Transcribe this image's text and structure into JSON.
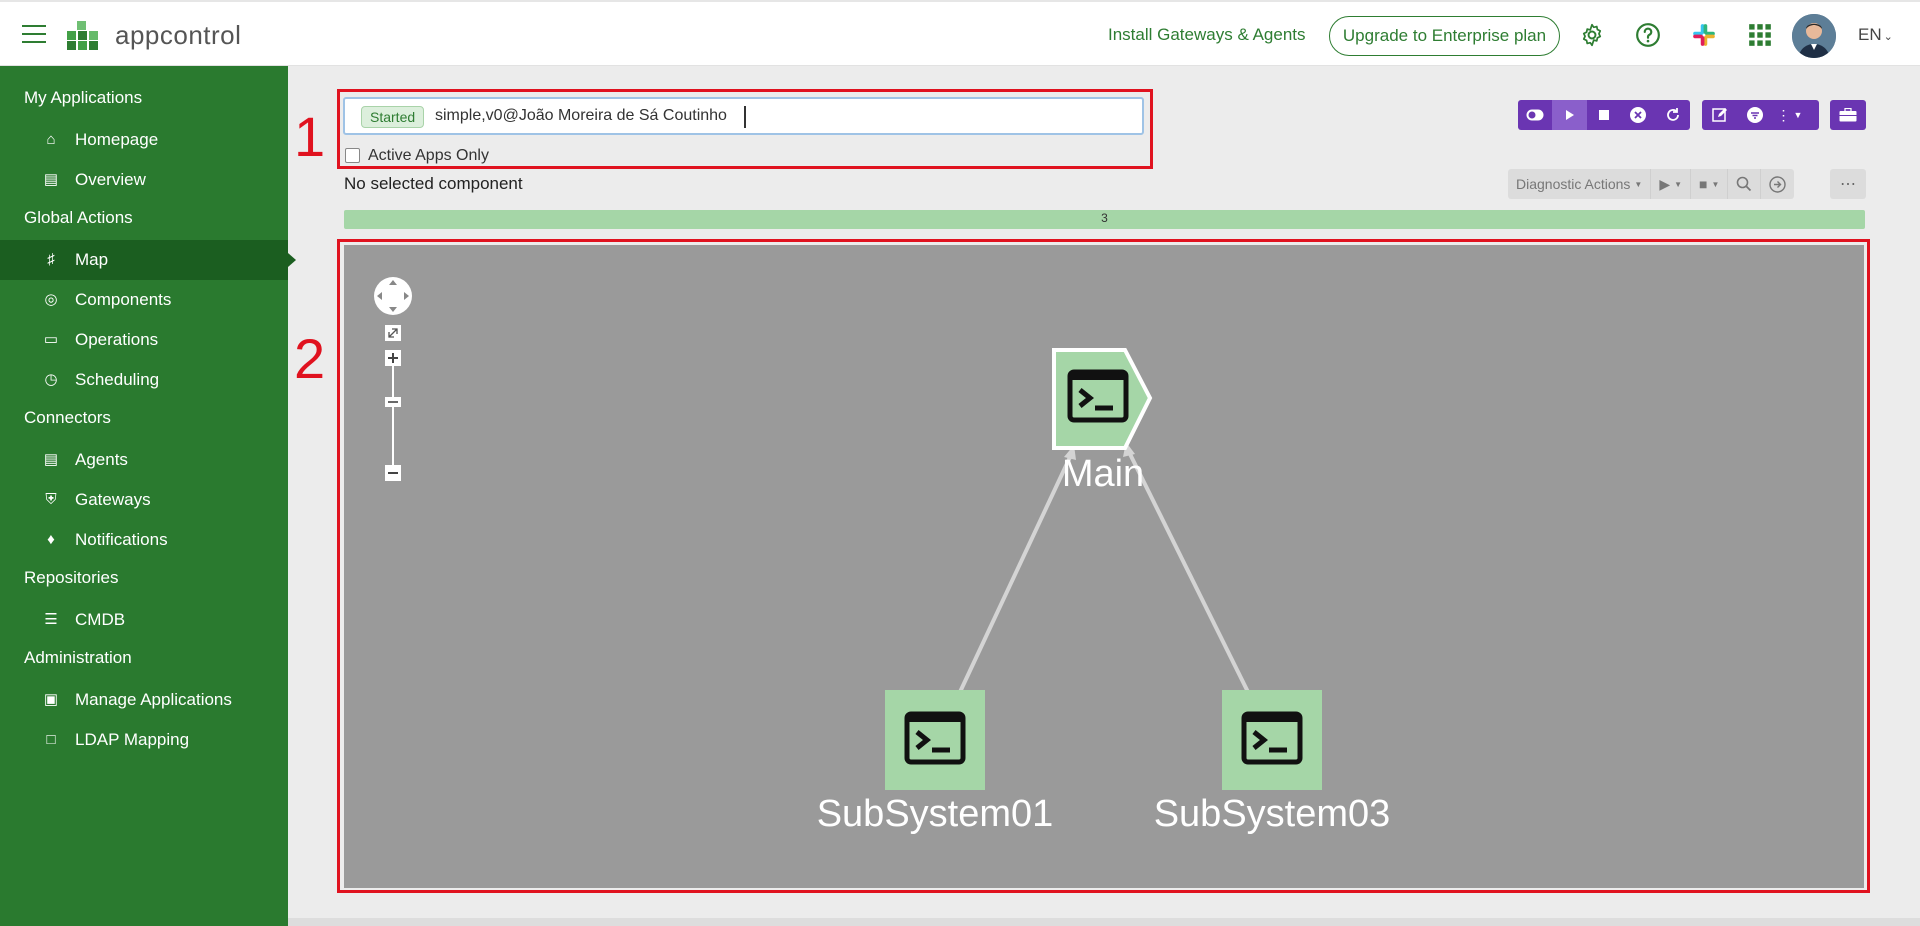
{
  "header": {
    "app_name": "appcontrol",
    "install_link": "Install Gateways & Agents",
    "upgrade_button": "Upgrade to Enterprise plan",
    "language": "EN",
    "icons": [
      "menu-icon",
      "settings-gear-icon",
      "help-icon",
      "slack-icon",
      "apps-grid-icon",
      "user-avatar"
    ]
  },
  "sidebar": {
    "sections": [
      {
        "label": "My Applications",
        "items": [
          {
            "label": "Homepage",
            "icon": "home-icon"
          },
          {
            "label": "Overview",
            "icon": "list-icon"
          }
        ]
      },
      {
        "label": "Global Actions",
        "items": [
          {
            "label": "Map",
            "icon": "sitemap-icon",
            "active": true
          },
          {
            "label": "Components",
            "icon": "globe-icon"
          },
          {
            "label": "Operations",
            "icon": "inbox-icon"
          },
          {
            "label": "Scheduling",
            "icon": "alarm-icon"
          }
        ]
      },
      {
        "label": "Connectors",
        "items": [
          {
            "label": "Agents",
            "icon": "server-icon"
          },
          {
            "label": "Gateways",
            "icon": "shield-icon"
          },
          {
            "label": "Notifications",
            "icon": "bell-icon"
          }
        ]
      },
      {
        "label": "Repositories",
        "items": [
          {
            "label": "CMDB",
            "icon": "database-icon"
          }
        ]
      },
      {
        "label": "Administration",
        "items": [
          {
            "label": "Manage Applications",
            "icon": "user-cog-icon"
          },
          {
            "label": "LDAP Mapping",
            "icon": "folder-icon"
          }
        ]
      }
    ],
    "colors": {
      "background": "#2a7a2f",
      "active": "#1b5e20"
    }
  },
  "toolbar": {
    "search": {
      "status_badge": "Started",
      "value": "simple,v0@João Moreira de Sá Coutinho"
    },
    "active_apps_only_label": "Active Apps Only",
    "active_apps_only_checked": false,
    "selection_status": "No selected component",
    "diagnostic_actions_label": "Diagnostic Actions",
    "progress_label": "3",
    "accent_color": "#6a35b2"
  },
  "annotations": {
    "box1": "1",
    "box2": "2",
    "color": "#e0121f"
  },
  "map": {
    "background": "#9a9a9a",
    "node_color": "#a5d6a7",
    "nodes": [
      {
        "id": "main",
        "label": "Main",
        "icon": "terminal-icon"
      },
      {
        "id": "sub1",
        "label": "SubSystem01",
        "icon": "terminal-icon"
      },
      {
        "id": "sub3",
        "label": "SubSystem03",
        "icon": "terminal-icon"
      }
    ],
    "edges": [
      {
        "from": "sub1",
        "to": "main"
      },
      {
        "from": "sub3",
        "to": "main"
      }
    ]
  }
}
